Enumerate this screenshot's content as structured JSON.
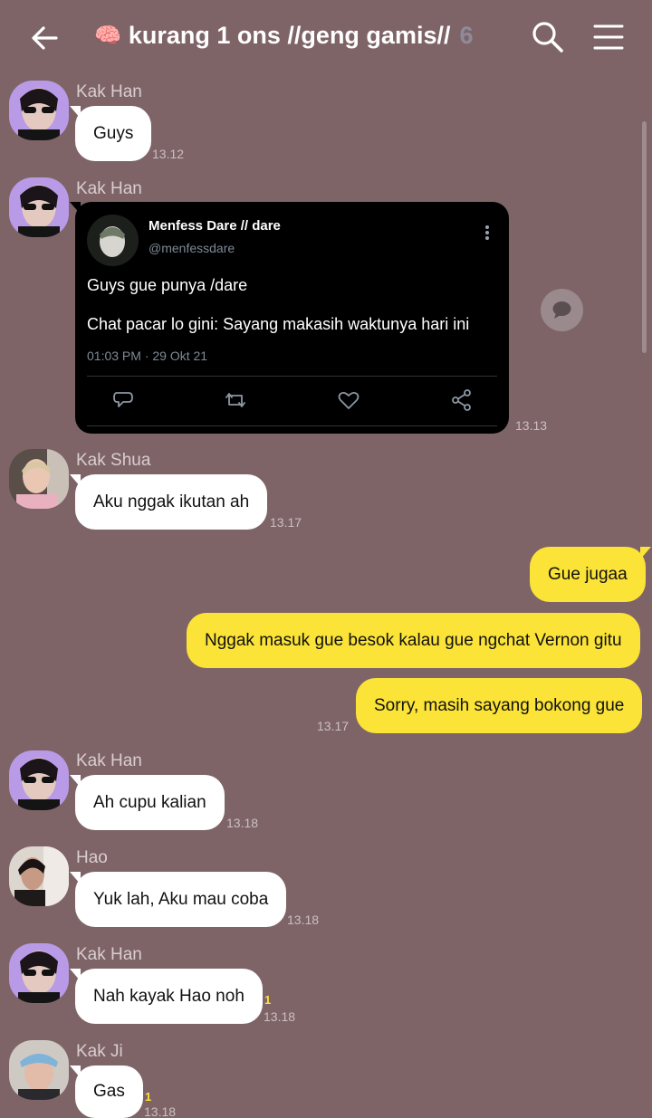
{
  "header": {
    "title": "kurang 1 ons //geng gamis//",
    "member_count": "6",
    "title_emoji": "🧠",
    "icons": [
      "back-arrow-icon",
      "search-icon",
      "menu-icon"
    ]
  },
  "colors": {
    "background": "#7e6467",
    "incoming_bubble": "#ffffff",
    "outgoing_bubble": "#fbe337",
    "unread_count": "#fbe337"
  },
  "messages": [
    {
      "sender": "Kak Han",
      "text": "Guys",
      "time": "13.12"
    },
    {
      "sender": "Kak Han",
      "time": "13.13",
      "tweet": {
        "name": "Menfess Dare // dare",
        "handle": "@menfessdare",
        "line1": "Guys gue punya /dare",
        "line2": "Chat pacar lo gini: Sayang makasih waktunya hari ini",
        "date": "01:03 PM · 29 Okt 21"
      }
    },
    {
      "sender": "Kak Shua",
      "text": "Aku nggak ikutan ah",
      "time": "13.17"
    },
    {
      "sender": "me",
      "text": "Gue jugaa"
    },
    {
      "sender": "me",
      "text": "Nggak masuk gue besok kalau gue ngchat Vernon gitu"
    },
    {
      "sender": "me",
      "text": "Sorry, masih sayang bokong gue",
      "time": "13.17"
    },
    {
      "sender": "Kak Han",
      "text": "Ah cupu kalian",
      "time": "13.18"
    },
    {
      "sender": "Hao",
      "text": "Yuk lah, Aku mau coba",
      "time": "13.18"
    },
    {
      "sender": "Kak Han",
      "text": "Nah kayak Hao noh",
      "time": "13.18",
      "unread": "1"
    },
    {
      "sender": "Kak Ji",
      "text": "Gas",
      "time": "13.18",
      "unread": "1"
    }
  ]
}
